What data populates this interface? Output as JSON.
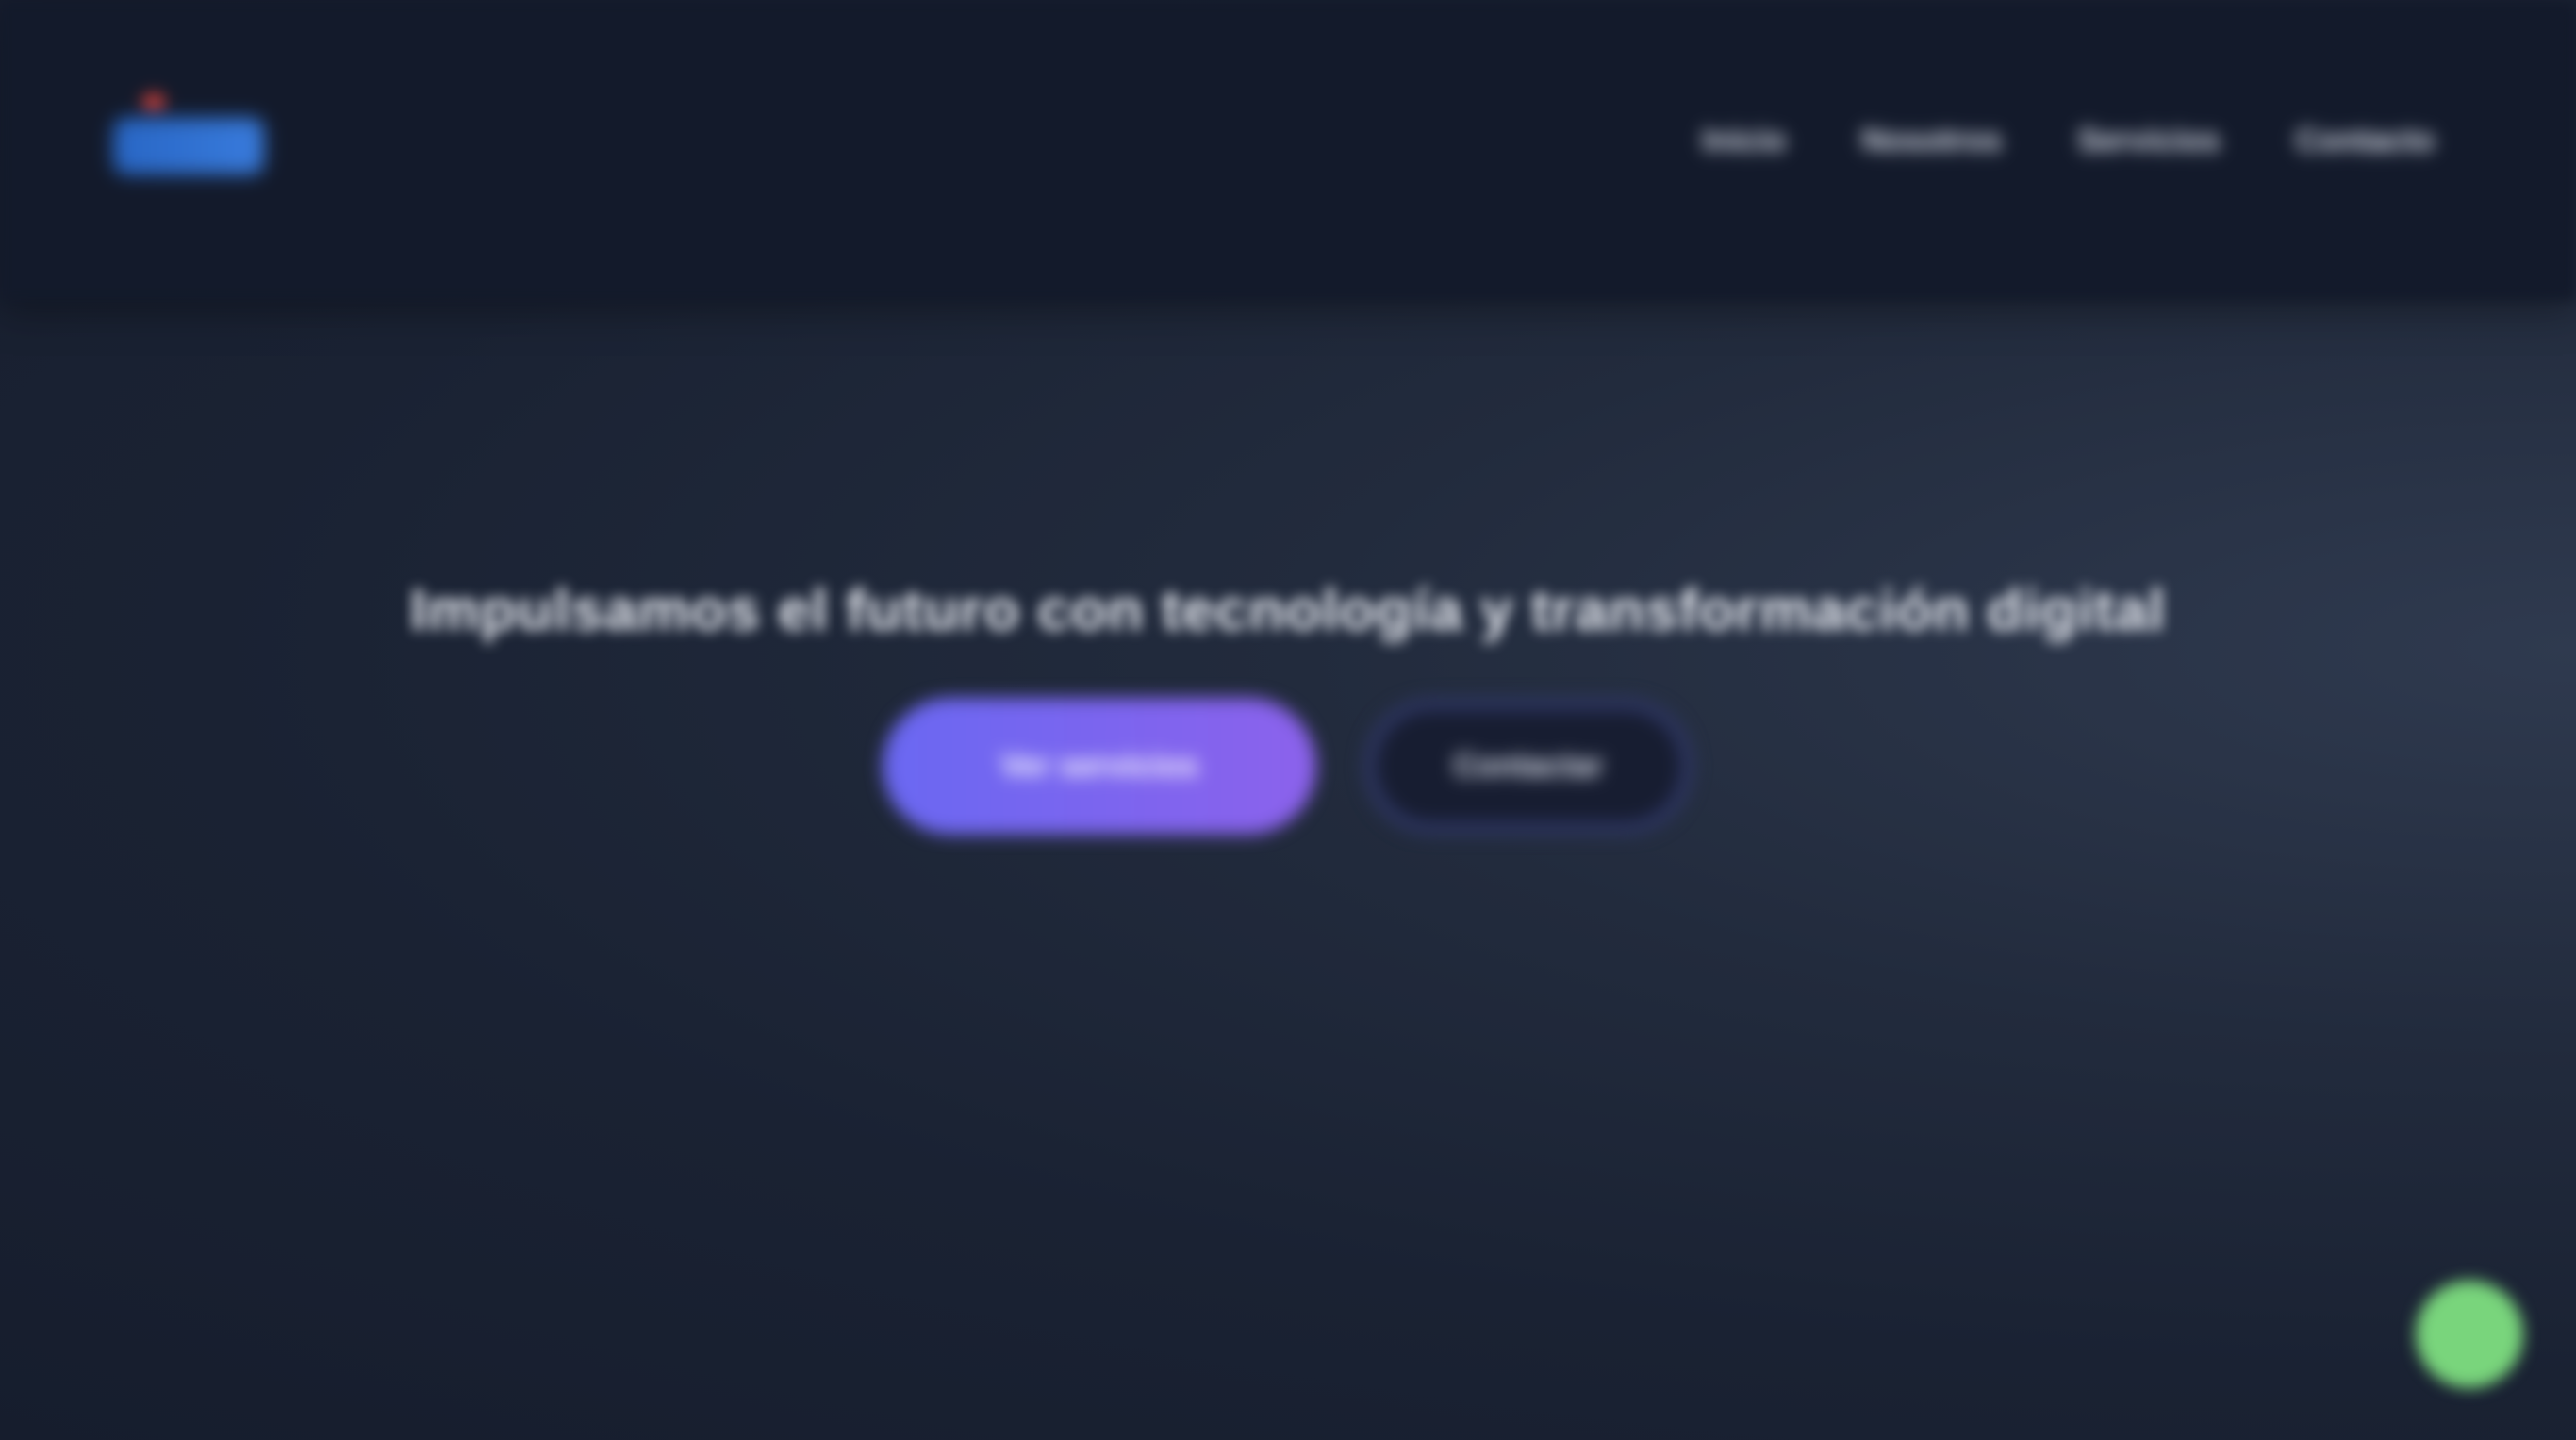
{
  "header": {
    "logo": {
      "icon": "company-logo-icon",
      "text": ""
    },
    "nav": {
      "items": [
        {
          "label": "Inicio"
        },
        {
          "label": "Nosotros"
        },
        {
          "label": "Servicios"
        },
        {
          "label": "Contacto"
        }
      ]
    }
  },
  "hero": {
    "title": "Impulsamos el futuro con tecnología y transformación digital",
    "primary_button": "Ver servicios",
    "secondary_button": "Contactar"
  },
  "chat": {
    "icon": "chat-bubble-icon"
  },
  "colors": {
    "background": "#1a2233",
    "header": "#131a2b",
    "accent_start": "#6a68f2",
    "accent_end": "#8c62ec",
    "chat_button": "#79d57c"
  }
}
